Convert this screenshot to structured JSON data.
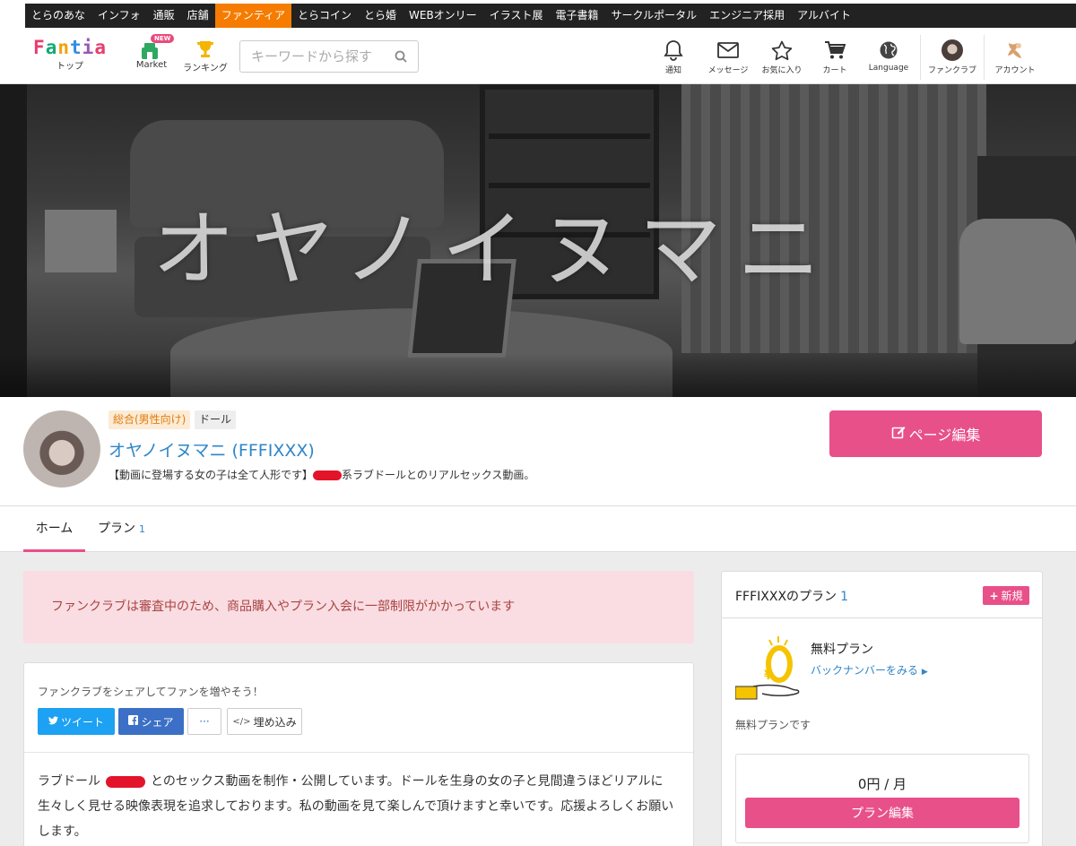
{
  "topbar": {
    "items": [
      "とらのあな",
      "インフォ",
      "通販",
      "店舗",
      "ファンティア",
      "とらコイン",
      "とら婚",
      "WEBオンリー",
      "イラスト展",
      "電子書籍",
      "サークルポータル",
      "エンジニア採用",
      "アルバイト"
    ],
    "active_index": 4
  },
  "header": {
    "logo_text": "Fantia",
    "logo_sub": "トップ",
    "market_label": "Market",
    "market_badge": "NEW",
    "ranking_label": "ランキング",
    "search_placeholder": "キーワードから探す",
    "nav": {
      "notify": "通知",
      "message": "メッセージ",
      "favorite": "お気に入り",
      "cart": "カート",
      "language": "Language",
      "fanclub": "ファンクラブ",
      "account": "アカウント"
    }
  },
  "banner": {
    "title": "オヤノイヌマニ"
  },
  "profile": {
    "tag_category": "総合(男性向け)",
    "tag_genre": "ドール",
    "name": "オヤノイヌマニ (FFFIXXX)",
    "desc_before": "【動画に登場する女の子は全て人形です】",
    "desc_after": "系ラブドールとのリアルセックス動画。",
    "edit_button": "ページ編集"
  },
  "tabs": {
    "home": "ホーム",
    "plan": "プラン",
    "plan_count": "1"
  },
  "alert": {
    "text": "ファンクラブは審査中のため、商品購入やプラン入会に一部制限がかかっています"
  },
  "share": {
    "heading": "ファンクラブをシェアしてファンを増やそう！",
    "tweet": "ツイート",
    "share": "シェア",
    "more": "···",
    "embed": "埋め込み"
  },
  "description": {
    "part1": "ラブドール",
    "part2": "とのセックス動画を制作・公開しています。ドールを生身の女の子と見間違うほどリアルに生々しく見せる映像表現を追求しております。私の動画を見て楽しんで頂けますと幸いです。応援よろしくお願いします。"
  },
  "plans": {
    "title": "FFFIXXXのプラン",
    "count": "1",
    "new_button": "新規",
    "plan_name": "無料プラン",
    "backnumber": "バックナンバーをみる",
    "note": "無料プランです",
    "price": "0円 / 月",
    "edit_button": "プラン編集"
  },
  "colors": {
    "accent_pink": "#e8508a",
    "fantia_orange": "#f57c00",
    "link_blue": "#2f86c9",
    "alert_bg": "#f9dde2"
  }
}
